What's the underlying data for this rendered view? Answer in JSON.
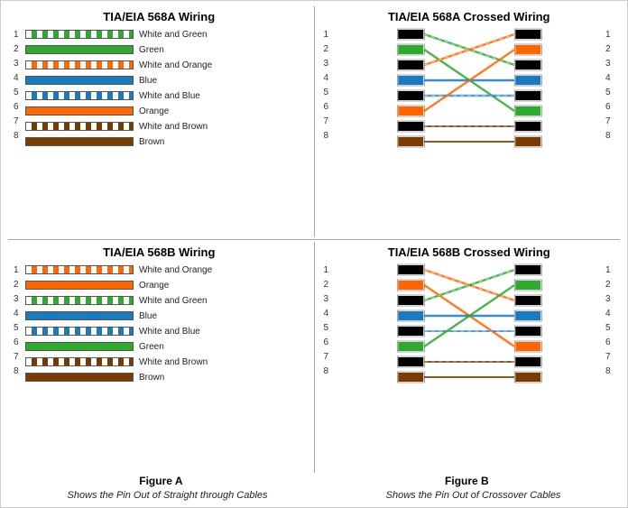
{
  "diagrams": {
    "568a_straight": {
      "title": "TIA/EIA 568A Wiring",
      "pins": [
        1,
        2,
        3,
        4,
        5,
        6,
        7,
        8
      ],
      "wires": [
        {
          "label": "White and Green",
          "type": "stripe-green"
        },
        {
          "label": "Green",
          "type": "solid-green"
        },
        {
          "label": "White and Orange",
          "type": "stripe-orange"
        },
        {
          "label": "Blue",
          "type": "solid-blue"
        },
        {
          "label": "White and Blue",
          "type": "stripe-blue"
        },
        {
          "label": "Orange",
          "type": "solid-orange"
        },
        {
          "label": "White and Brown",
          "type": "stripe-brown"
        },
        {
          "label": "Brown",
          "type": "solid-brown"
        }
      ]
    },
    "568b_straight": {
      "title": "TIA/EIA 568B Wiring",
      "pins": [
        1,
        2,
        3,
        4,
        5,
        6,
        7,
        8
      ],
      "wires": [
        {
          "label": "White and Orange",
          "type": "stripe-orange"
        },
        {
          "label": "Orange",
          "type": "solid-orange"
        },
        {
          "label": "White and Green",
          "type": "stripe-green"
        },
        {
          "label": "Blue",
          "type": "solid-blue"
        },
        {
          "label": "White and Blue",
          "type": "stripe-blue"
        },
        {
          "label": "Green",
          "type": "solid-green"
        },
        {
          "label": "White and Brown",
          "type": "stripe-brown"
        },
        {
          "label": "Brown",
          "type": "solid-brown"
        }
      ]
    },
    "568a_crossed_title": "TIA/EIA 568A Crossed Wiring",
    "568b_crossed_title": "TIA/EIA 568B Crossed Wiring",
    "figure_a": "Figure A",
    "figure_b": "Figure B",
    "caption_a": "Shows the Pin Out of Straight through Cables",
    "caption_b": "Shows the Pin Out of Crossover Cables"
  }
}
